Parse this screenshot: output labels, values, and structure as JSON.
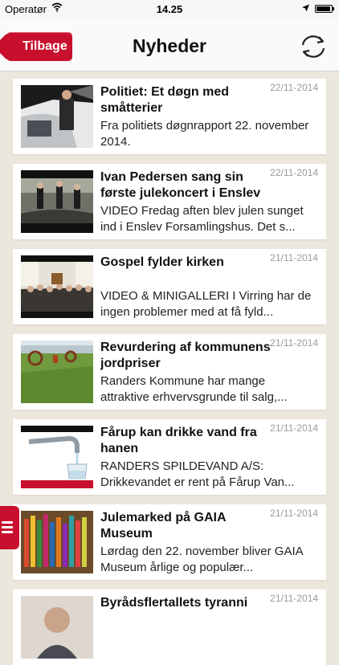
{
  "status": {
    "carrier": "Operatør",
    "time": "14.25"
  },
  "nav": {
    "back_label": "Tilbage",
    "title": "Nyheder"
  },
  "articles": [
    {
      "title": "Politiet: Et døgn med småtterier",
      "date": "22/11-2014",
      "summary": "Fra politiets døgnrapport 22. november 2014."
    },
    {
      "title": "Ivan Pedersen sang sin første julekoncert i Enslev",
      "date": "22/11-2014",
      "summary": "VIDEO Fredag aften blev julen sunget ind i Enslev Forsamlingshus. Det s..."
    },
    {
      "title": "Gospel fylder kirken",
      "date": "21/11-2014",
      "summary": "VIDEO & MINIGALLERI I Virring har de ingen problemer med at få fyld..."
    },
    {
      "title": "Revurdering af kommunens jordpriser",
      "date": "21/11-2014",
      "summary": "Randers Kommune har mange attraktive erhvervsgrunde til salg,..."
    },
    {
      "title": "Fårup kan drikke vand fra hanen",
      "date": "21/11-2014",
      "summary": "RANDERS SPILDEVAND A/S: Drikkevandet er rent på Fårup Van..."
    },
    {
      "title": "Julemarked på GAIA Museum",
      "date": "21/11-2014",
      "summary": "Lørdag den 22. november bliver GAIA Museum årlige og populær..."
    },
    {
      "title": "Byrådsflertallets tyranni",
      "date": "21/11-2014",
      "summary": ""
    }
  ]
}
